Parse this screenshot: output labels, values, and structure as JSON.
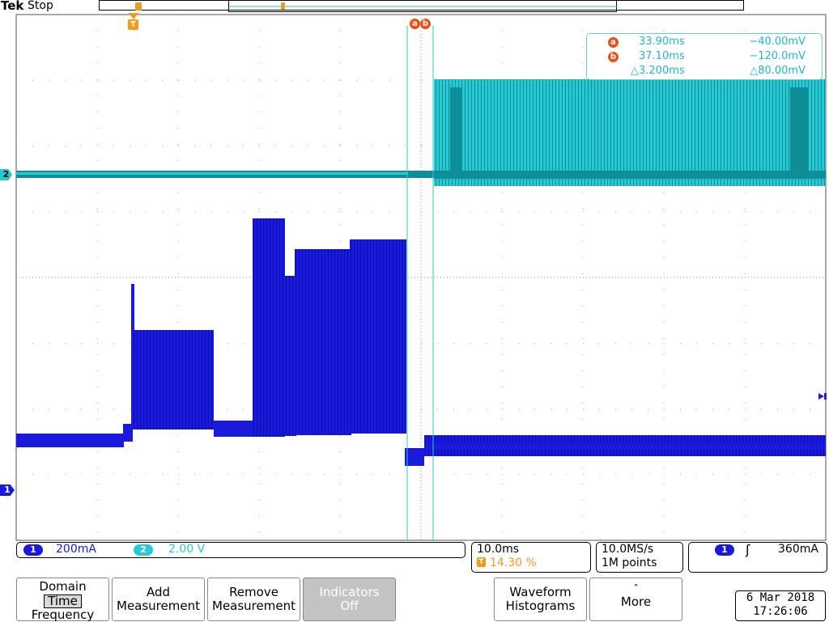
{
  "header": {
    "brand": "Tek",
    "acq_state": "Stop"
  },
  "cursors": {
    "a_label": "a",
    "b_label": "b",
    "a_time": "33.90ms",
    "a_value": "−40.00mV",
    "b_time": "37.10ms",
    "b_value": "−120.0mV",
    "delta_time": "△3.200ms",
    "delta_value": "△80.00mV"
  },
  "markers": {
    "trigger": "T",
    "ch2": "2",
    "ch1": "1"
  },
  "channels": {
    "ch1": {
      "label": "1",
      "scale": "200mA",
      "color": "#1a1adc"
    },
    "ch2": {
      "label": "2",
      "scale": "2.00 V",
      "color": "#26c9d4"
    }
  },
  "timebase": {
    "scale": "10.0ms",
    "trigger_icon": "T",
    "position": "14.30 %"
  },
  "acquisition": {
    "rate": "10.0MS/s",
    "points": "1M points"
  },
  "trigger": {
    "source": "1",
    "slope_icon": "rising-edge-icon",
    "slope": "ʃ",
    "level": "360mA"
  },
  "buttons": {
    "domain": {
      "line1": "Domain",
      "selected": "Time",
      "line3": "Frequency"
    },
    "add": {
      "line1": "Add",
      "line2": "Measurement"
    },
    "remove": {
      "line1": "Remove",
      "line2": "Measurement"
    },
    "indicators": {
      "line1": "Indicators",
      "line2": "Off"
    },
    "histograms": {
      "line1": "Waveform",
      "line2": "Histograms"
    },
    "more": {
      "arrow": "ˆ",
      "label": "More"
    }
  },
  "datetime": {
    "date": "6 Mar 2018",
    "time": "17:26:06"
  }
}
